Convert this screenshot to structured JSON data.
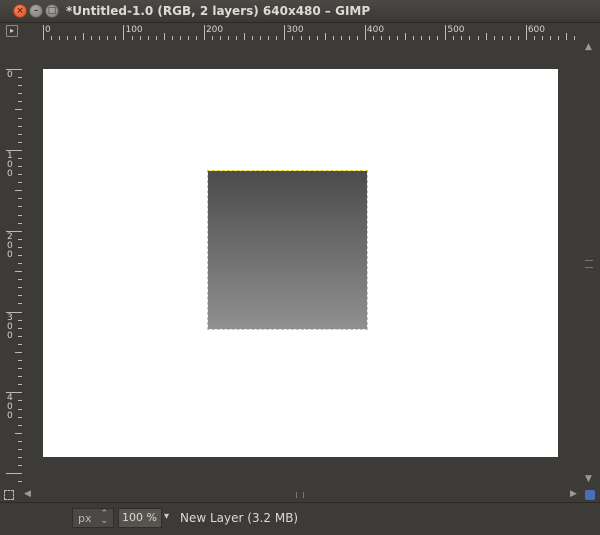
{
  "window": {
    "title": "*Untitled-1.0 (RGB, 2 layers) 640x480 – GIMP",
    "close_glyph": "×",
    "minimize_glyph": "–",
    "maximize_glyph": "□"
  },
  "rulers": {
    "top_labels": [
      "0",
      "100",
      "200",
      "300",
      "400",
      "500",
      "600"
    ],
    "left_labels": [
      "0",
      "100",
      "200",
      "300",
      "400"
    ]
  },
  "icons": {
    "ruler_corner": "quick-mask-toggle-icon",
    "side": "zoom-image-when-window-size-changes-icon",
    "navigate": "navigate-image-icon"
  },
  "colors": {
    "chrome": "#3c3b37",
    "canvas": "#ffffff",
    "selection": "#e6d800",
    "layer_top": "#4b4b4b",
    "layer_bottom": "#909090"
  },
  "status": {
    "unit": "px",
    "zoom": "100 %",
    "layer_info": "New Layer (3.2 MB)"
  }
}
